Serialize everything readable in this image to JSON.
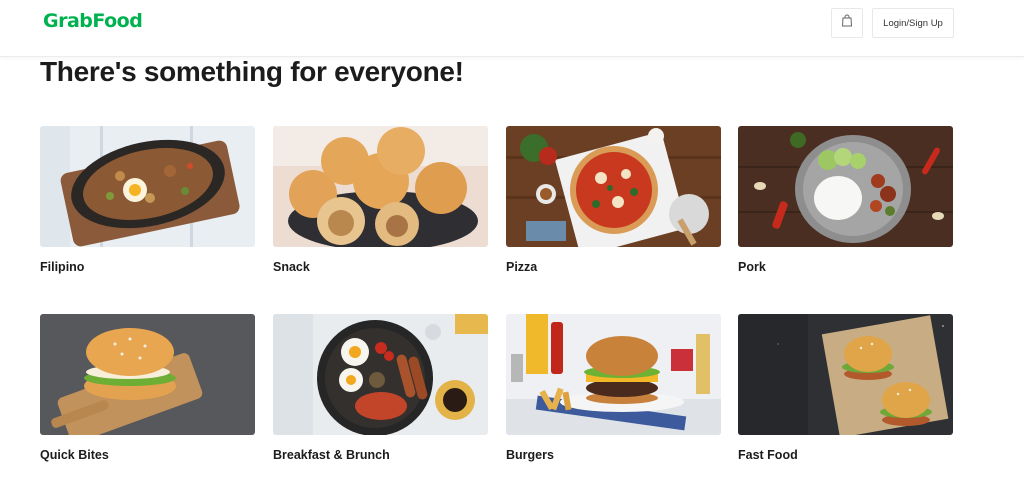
{
  "header": {
    "logo": "GrabFood",
    "cart_icon": "shopping-bag-icon",
    "login_label": "Login/Sign Up"
  },
  "main": {
    "heading": "There's something for everyone!",
    "categories": [
      {
        "label": "Filipino",
        "image": "sisig-skillet-photo"
      },
      {
        "label": "Snack",
        "image": "siopao-buns-photo"
      },
      {
        "label": "Pizza",
        "image": "pizza-board-photo"
      },
      {
        "label": "Pork",
        "image": "pork-rice-plate-photo"
      },
      {
        "label": "Quick Bites",
        "image": "bagel-sandwich-photo"
      },
      {
        "label": "Breakfast & Brunch",
        "image": "english-breakfast-photo"
      },
      {
        "label": "Burgers",
        "image": "cheeseburger-fries-photo"
      },
      {
        "label": "Fast Food",
        "image": "two-burgers-photo"
      }
    ]
  },
  "colors": {
    "brand": "#00b14f",
    "text": "#1c1c1c",
    "border": "#e8e8e8"
  }
}
